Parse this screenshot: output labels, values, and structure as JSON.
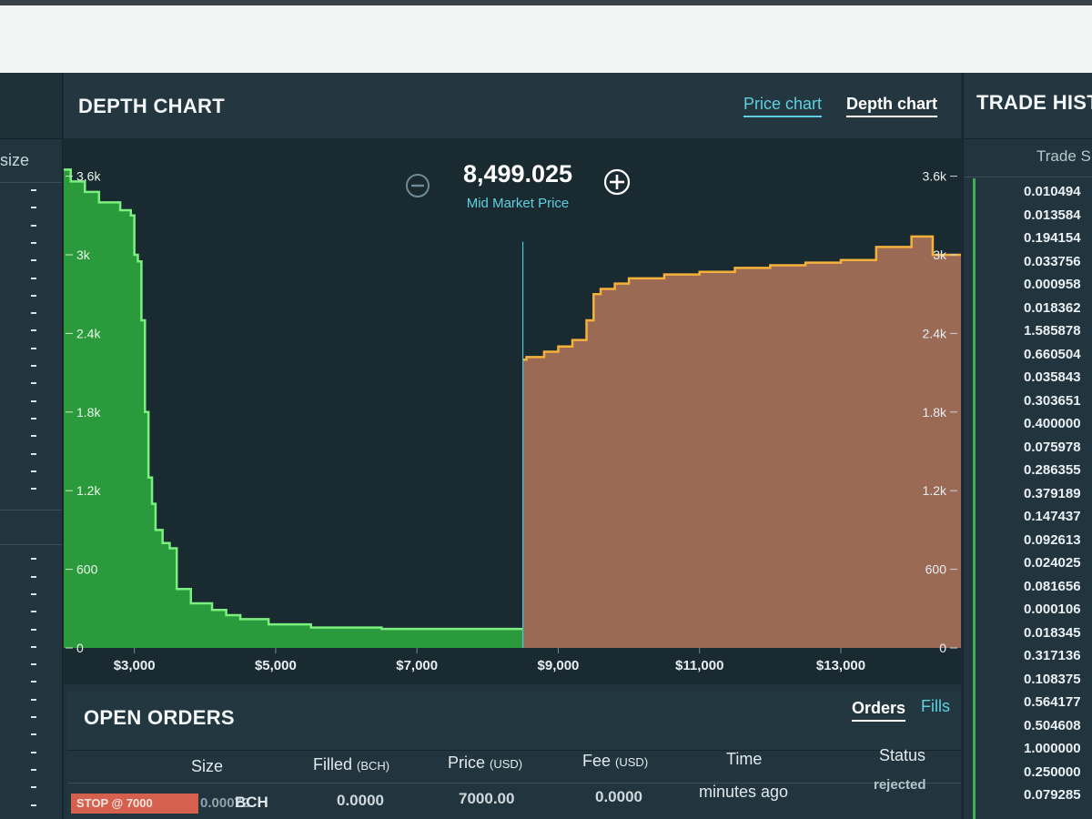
{
  "depth": {
    "title": "DEPTH CHART",
    "tabs": [
      {
        "label": "Price chart",
        "active": false
      },
      {
        "label": "Depth chart",
        "active": true
      }
    ],
    "mid_price": "8,499.025",
    "mid_label": "Mid Market Price"
  },
  "left": {
    "size_label": "size"
  },
  "trade_history": {
    "title": "TRADE HIST",
    "col_header": "Trade S",
    "rows": [
      "0.010494",
      "0.013584",
      "0.194154",
      "0.033756",
      "0.000958",
      "0.018362",
      "1.585878",
      "0.660504",
      "0.035843",
      "0.303651",
      "0.400000",
      "0.075978",
      "0.286355",
      "0.379189",
      "0.147437",
      "0.092613",
      "0.024025",
      "0.081656",
      "0.000106",
      "0.018345",
      "0.317136",
      "0.108375",
      "0.564177",
      "0.504608",
      "1.000000",
      "0.250000",
      "0.079285"
    ]
  },
  "orders": {
    "title": "OPEN ORDERS",
    "tabs": [
      {
        "label": "Orders",
        "active": true
      },
      {
        "label": "Fills",
        "active": false
      }
    ],
    "columns": {
      "size": "Size",
      "filled": "Filled",
      "filled_unit": "(BCH)",
      "price": "Price",
      "price_unit": "(USD)",
      "fee": "Fee",
      "fee_unit": "(USD)",
      "time": "Time",
      "status": "Status"
    },
    "row": {
      "stop_badge": "STOP @ 7000",
      "size": "0.00072",
      "size_unit": "BCH",
      "filled": "0.0000",
      "price": "7000.00",
      "fee": "0.0000",
      "time": "minutes ago",
      "status": "rejected"
    }
  },
  "colors": {
    "bid": "#2a9a3c",
    "bid_line": "#7cf07f",
    "ask": "#9a6a55",
    "ask_line": "#f6b13b",
    "accent": "#47c7d9"
  },
  "chart_data": {
    "type": "area",
    "title": "DEPTH CHART",
    "x_ticks": [
      "$3,000",
      "$5,000",
      "$7,000",
      "$9,000",
      "$11,000",
      "$13,000"
    ],
    "x_tick_values": [
      3000,
      5000,
      7000,
      9000,
      11000,
      13000
    ],
    "y_ticks_left": [
      "0",
      "600",
      "1.2k",
      "1.8k",
      "2.4k",
      "3k",
      "3.6k"
    ],
    "y_ticks_right": [
      "0",
      "600",
      "1.2k",
      "1.8k",
      "2.4k",
      "3k",
      "3.6k"
    ],
    "y_tick_values": [
      0,
      600,
      1200,
      1800,
      2400,
      3000,
      3600
    ],
    "xlim": [
      2000,
      14700
    ],
    "ylim": [
      0,
      3750
    ],
    "mid_price": 8499.025,
    "series": [
      {
        "name": "bids",
        "x": [
          2000,
          2100,
          2300,
          2500,
          2800,
          2950,
          3000,
          3050,
          3100,
          3150,
          3200,
          3250,
          3300,
          3400,
          3500,
          3600,
          3800,
          4100,
          4300,
          4500,
          4900,
          5500,
          6500,
          7500,
          8499
        ],
        "y": [
          3650,
          3560,
          3480,
          3400,
          3340,
          3300,
          3000,
          2950,
          2500,
          1800,
          1300,
          1100,
          900,
          800,
          760,
          450,
          340,
          290,
          250,
          220,
          180,
          155,
          145,
          145,
          150
        ]
      },
      {
        "name": "asks",
        "x": [
          8499,
          8550,
          8800,
          9000,
          9200,
          9400,
          9500,
          9600,
          9800,
          10000,
          10500,
          11000,
          11500,
          12000,
          12500,
          13000,
          13500,
          14000,
          14300,
          14700
        ],
        "y": [
          2200,
          2220,
          2260,
          2300,
          2350,
          2500,
          2700,
          2740,
          2780,
          2820,
          2850,
          2870,
          2900,
          2920,
          2940,
          2960,
          3060,
          3140,
          3000,
          3000
        ]
      }
    ]
  }
}
